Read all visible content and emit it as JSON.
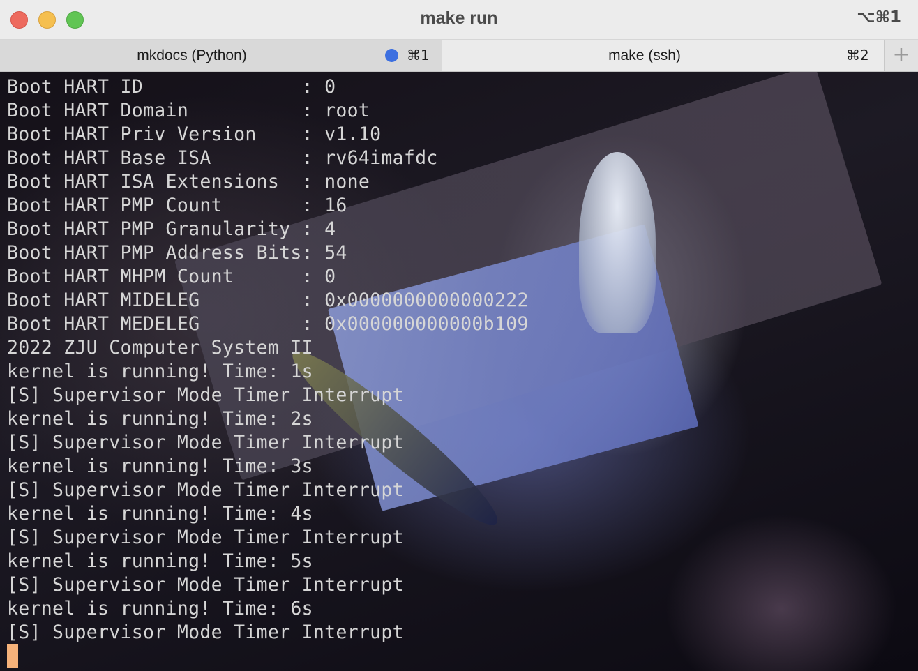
{
  "window": {
    "title": "make run",
    "title_shortcut": "⌥⌘1"
  },
  "tabs": [
    {
      "label": "mkdocs (Python)",
      "shortcut": "⌘1",
      "active": true,
      "indicator_color": "#3c6fe0"
    },
    {
      "label": "make (ssh)",
      "shortcut": "⌘2",
      "active": false
    }
  ],
  "new_tab_label": "+",
  "terminal": {
    "lines": [
      "Boot HART ID              : 0",
      "Boot HART Domain          : root",
      "Boot HART Priv Version    : v1.10",
      "Boot HART Base ISA        : rv64imafdc",
      "Boot HART ISA Extensions  : none",
      "Boot HART PMP Count       : 16",
      "Boot HART PMP Granularity : 4",
      "Boot HART PMP Address Bits: 54",
      "Boot HART MHPM Count      : 0",
      "Boot HART MIDELEG         : 0x0000000000000222",
      "Boot HART MEDELEG         : 0x000000000000b109",
      "2022 ZJU Computer System II",
      "kernel is running! Time: 1s",
      "[S] Supervisor Mode Timer Interrupt",
      "kernel is running! Time: 2s",
      "[S] Supervisor Mode Timer Interrupt",
      "kernel is running! Time: 3s",
      "[S] Supervisor Mode Timer Interrupt",
      "kernel is running! Time: 4s",
      "[S] Supervisor Mode Timer Interrupt",
      "kernel is running! Time: 5s",
      "[S] Supervisor Mode Timer Interrupt",
      "kernel is running! Time: 6s",
      "[S] Supervisor Mode Timer Interrupt"
    ],
    "text_color": "#d6d6d6",
    "cursor_color": "#f6b27a"
  },
  "colors": {
    "close": "#ed6a5e",
    "minimize": "#f5bf4f",
    "zoom": "#61c554"
  }
}
